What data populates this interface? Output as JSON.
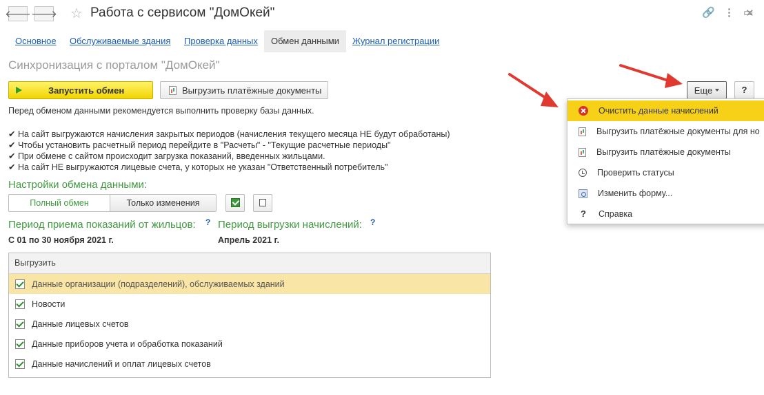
{
  "window": {
    "title": "Работа с сервисом \"ДомОкей\"",
    "back_glyph": "🡐",
    "forward_glyph": "🡒",
    "star_glyph": "☆",
    "link_glyph": "🔗",
    "menu_glyph": "⋮",
    "maximize_glyph": "▭",
    "close_glyph": "✕"
  },
  "tabs": [
    {
      "label": "Основное"
    },
    {
      "label": "Обслуживаемые здания"
    },
    {
      "label": "Проверка данных"
    },
    {
      "label": "Обмен данными"
    },
    {
      "label": "Журнал регистрации"
    }
  ],
  "section_title": "Синхронизация с порталом \"ДомОкей\"",
  "toolbar": {
    "start_label": "Запустить обмен",
    "upload_docs_label": "Выгрузить платёжные документы",
    "more_label": "Еще",
    "help_label": "?"
  },
  "info": {
    "recommendation": "Перед обменом данными рекомендуется выполнить проверку базы данных.",
    "bullets": [
      "✔ На сайт выгружаются начисления закрытых периодов (начисления текущего месяца НЕ будут обработаны)",
      "✔ Чтобы установить расчетный период перейдите в \"Расчеты\" - \"Текущие расчетные периоды\"",
      "✔ При обмене с сайтом происходит загрузка показаний, введенных жильцами.",
      "✔ На сайт НЕ выгружаются лицевые счета, у которых не указан \"Ответственный потребитель\""
    ]
  },
  "settings": {
    "heading": "Настройки обмена данными:",
    "full_exchange": "Полный обмен",
    "changes_only": "Только изменения"
  },
  "periods": {
    "readings_label": "Период приема показаний от жильцов:",
    "readings_help": "?",
    "readings_value": "С 01 по 30 ноября 2021 г.",
    "charges_label": "Период выгрузки начислений:",
    "charges_help": "?",
    "charges_value": "Апрель 2021 г."
  },
  "upload_table": {
    "header": "Выгрузить",
    "rows": [
      {
        "label": "Данные организации (подразделений), обслуживаемых зданий",
        "checked": true
      },
      {
        "label": "Новости",
        "checked": true
      },
      {
        "label": "Данные лицевых счетов",
        "checked": true
      },
      {
        "label": "Данные приборов учета и обработка показаний",
        "checked": true
      },
      {
        "label": "Данные начислений и оплат лицевых счетов",
        "checked": true
      }
    ]
  },
  "more_menu": {
    "items": [
      {
        "label": "Очистить данные начислений",
        "icon": "clear-x-icon"
      },
      {
        "label": "Выгрузить платёжные документы для но",
        "icon": "document-chart-icon"
      },
      {
        "label": "Выгрузить платёжные документы",
        "icon": "document-chart-icon"
      },
      {
        "label": "Проверить статусы",
        "icon": "history-icon"
      },
      {
        "label": "Изменить форму...",
        "icon": "form-settings-icon"
      },
      {
        "label": "Справка",
        "icon": "help-icon"
      }
    ],
    "help_glyph": "?"
  },
  "colors": {
    "accent_yellow": "#f2d500",
    "link_blue": "#1c5eaf",
    "heading_green": "#3f9a3f",
    "selected_row": "#f9e5a6",
    "arrow_red": "#e03a30"
  }
}
